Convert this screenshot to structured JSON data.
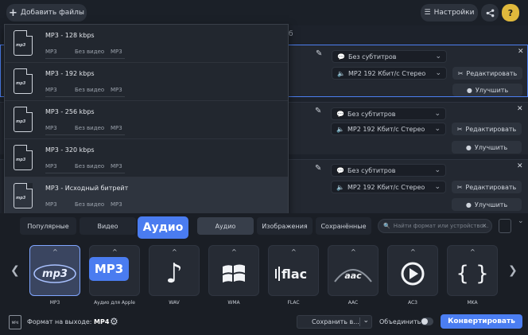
{
  "toolbar": {
    "add_files": "Добавить файлы",
    "settings": "Настройки",
    "help": "?",
    "tab_partial": "б"
  },
  "rows": [
    {
      "subtitles": "Без субтитров",
      "audio": "MP2 192 Кбит/с Стерео",
      "edit": "Редактировать",
      "improve": "Улучшить"
    },
    {
      "subtitles": "Без субтитров",
      "audio": "MP2 192 Кбит/с Стерео",
      "edit": "Редактировать",
      "improve": "Улучшить"
    },
    {
      "subtitles": "Без субтитров",
      "audio": "MP2 192 Кбит/с Стерео",
      "edit": "Редактировать",
      "improve": "Улучшить"
    }
  ],
  "presets": [
    {
      "name": "MP3 - 128 kbps",
      "fmt": "MP3",
      "video": "Без видео",
      "audio": "MP3"
    },
    {
      "name": "MP3 - 192 kbps",
      "fmt": "MP3",
      "video": "Без видео",
      "audio": "MP3"
    },
    {
      "name": "MP3 - 256 kbps",
      "fmt": "MP3",
      "video": "Без видео",
      "audio": "MP3"
    },
    {
      "name": "MP3 - 320 kbps",
      "fmt": "MP3",
      "video": "Без видео",
      "audio": "MP3"
    },
    {
      "name": "MP3 - Исходный битрейт",
      "fmt": "MP3",
      "video": "Без видео",
      "audio": "MP3"
    }
  ],
  "preset_icon_text": "mp3",
  "format_tabs": [
    "Популярные",
    "Видео",
    "Аудио",
    "Изображения",
    "Сохранённые"
  ],
  "active_tab": "Аудио",
  "search": {
    "placeholder": "Найти формат или устройство..."
  },
  "tooltips": {
    "audio": "Аудио",
    "mp3": "MP3"
  },
  "formats": [
    {
      "label": "MP3",
      "logo": "mp3"
    },
    {
      "label": "Аудио для Apple",
      "logo": "apple"
    },
    {
      "label": "WAV",
      "logo": "note"
    },
    {
      "label": "WMA",
      "logo": "windows"
    },
    {
      "label": "FLAC",
      "logo": "flac"
    },
    {
      "label": "AAC",
      "logo": "aac"
    },
    {
      "label": "AC3",
      "logo": "play"
    },
    {
      "label": "MKA",
      "logo": "braces"
    }
  ],
  "bottom": {
    "output_icon": "MP4",
    "output_label": "Формат на выходе:",
    "output_value": "MP4",
    "save_in": "Сохранить в...",
    "merge": "Объединить:",
    "convert": "Конвертировать"
  },
  "colors": {
    "accent": "#4b7ef2",
    "help": "#e0b93c",
    "background": "#1d222b"
  }
}
